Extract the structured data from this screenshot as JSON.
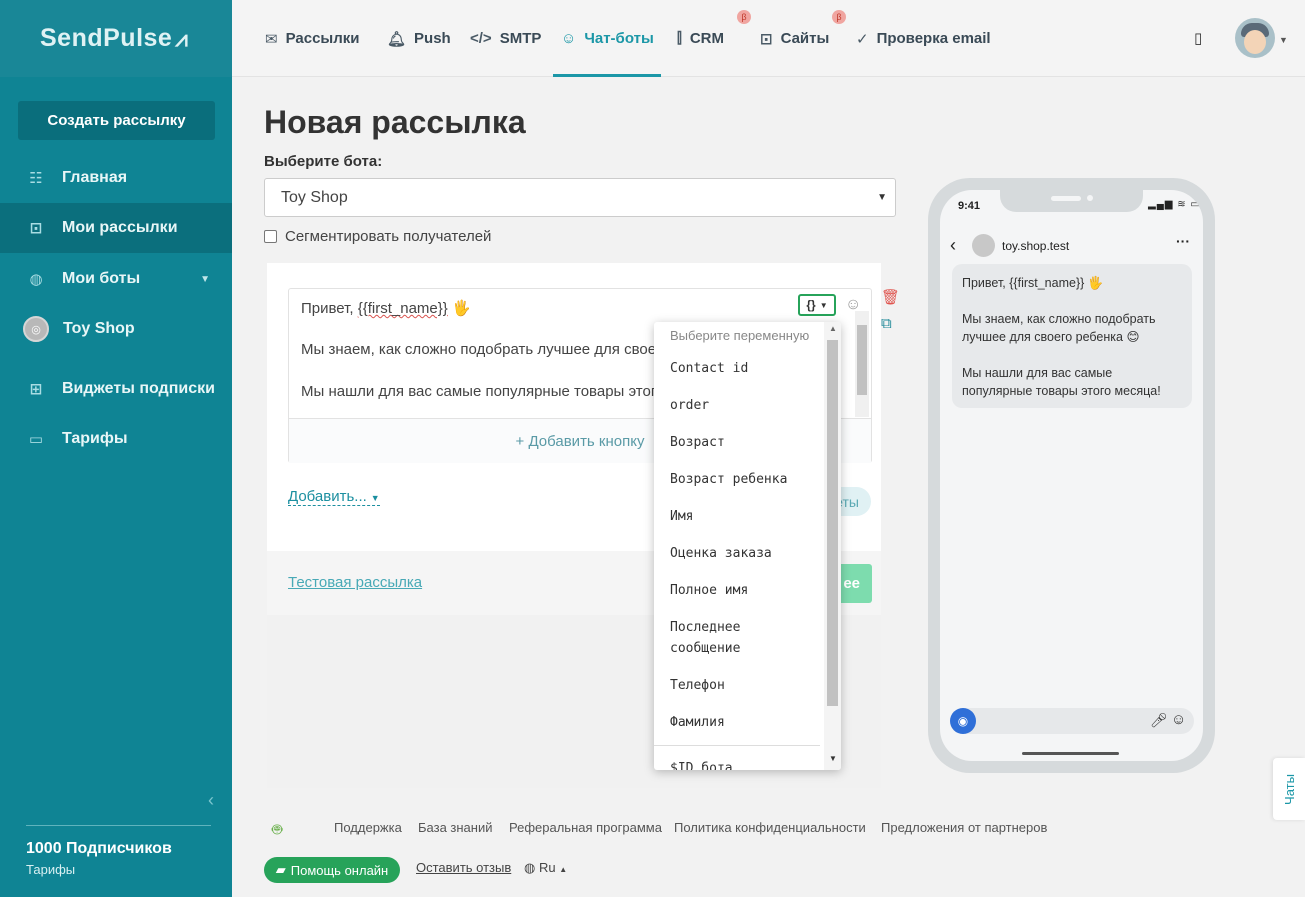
{
  "brand": {
    "logo_text": "SendPulse",
    "logo_mark": "⩘"
  },
  "sidebar": {
    "create_button": "Создать рассылку",
    "items": [
      {
        "label": "Главная",
        "icon": "sliders-icon"
      },
      {
        "label": "Мои рассылки",
        "icon": "inbox-icon"
      },
      {
        "label": "Мои боты",
        "icon": "globe-icon"
      },
      {
        "label": "Toy Shop",
        "icon": "instagram-icon"
      },
      {
        "label": "Виджеты подписки",
        "icon": "widget-icon"
      },
      {
        "label": "Тарифы",
        "icon": "wallet-icon"
      }
    ],
    "subscribers": "1000 Подписчиков",
    "plan_link": "Тарифы"
  },
  "topnav": {
    "items": [
      {
        "label": "Рассылки",
        "icon": "envelope-icon"
      },
      {
        "label": "Push",
        "icon": "bell-icon"
      },
      {
        "label": "SMTP",
        "icon": "code-icon"
      },
      {
        "label": "Чат-боты",
        "icon": "chat-bot-icon"
      },
      {
        "label": "CRM",
        "icon": "crm-icon"
      },
      {
        "label": "Сайты",
        "icon": "site-icon"
      },
      {
        "label": "Проверка email",
        "icon": "check-circle-icon"
      }
    ],
    "active": "Чат-боты",
    "beta_badge": "β",
    "accent_color": "#1b97a7"
  },
  "main": {
    "title": "Новая рассылка",
    "bot_label": "Выберите бота:",
    "bot_selected": "Toy Shop",
    "segment_label": "Сегментировать получателей",
    "editor": {
      "line1_prefix": "Привет,  ",
      "line1_var": "{{first_name}}",
      "line1_emoji": "🖐",
      "line2": "Мы знаем, как сложно подобрать лучшее для своего ребенка",
      "line3": "Мы нашли для вас самые популярные товары этого месяца!",
      "var_button": "{}",
      "add_button": "+ Добавить кнопку"
    },
    "add_more": "Добавить...",
    "pill_label": "еты",
    "test_link": "Тестовая рассылка",
    "send_button": "ее"
  },
  "dropdown": {
    "header": "Выберите переменную",
    "items": [
      "Contact id",
      "order",
      "Возраст",
      "Возраст ребенка",
      "Имя",
      "Оценка заказа",
      "Полное имя",
      "Последнее сообщение",
      "Телефон",
      "Фамилия",
      "$ID бота"
    ]
  },
  "preview": {
    "time": "9:41",
    "status": "▂▄▆ ≋ ▭",
    "chat_name": "toy.shop.test",
    "messages": [
      "Привет,  {{first_name}} 🖐",
      "Мы знаем, как сложно подобрать лучшее для своего ребенка 😊",
      "Мы нашли для вас самые популярные товары этого месяца!"
    ]
  },
  "chats_tab": "Чаты",
  "footer": {
    "links": [
      "Поддержка",
      "База знаний",
      "Реферальная программа",
      "Политика конфиденциальности",
      "Предложения от партнеров"
    ],
    "help_button": "Помощь онлайн",
    "feedback": "Оставить отзыв",
    "language": "Ru"
  }
}
